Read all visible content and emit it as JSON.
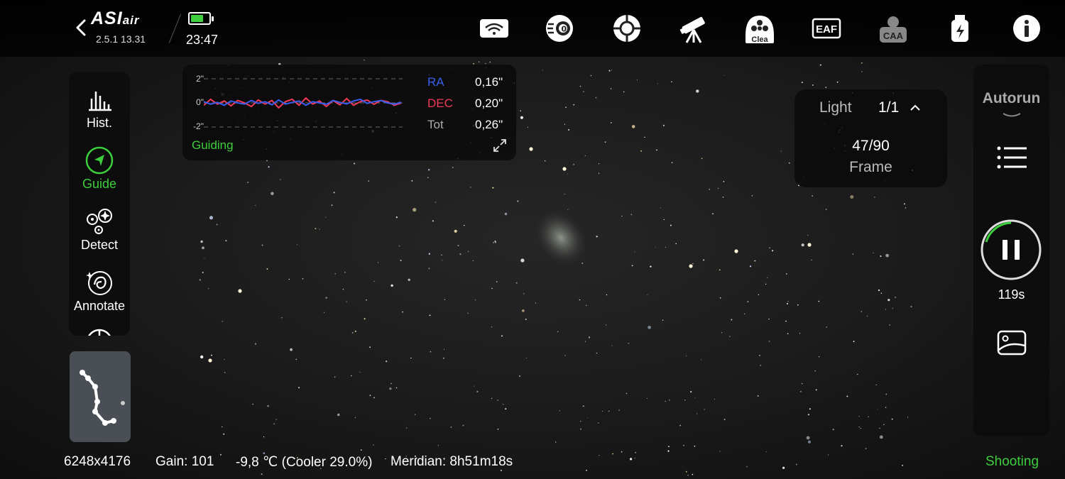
{
  "app": {
    "logo_main": "ASI",
    "logo_sub": "air",
    "version": "2.5.1 13.31",
    "clock": "23:47",
    "battery_level": 0.7
  },
  "topbar": {
    "icons": [
      {
        "name": "wifi-icon",
        "label": ""
      },
      {
        "name": "camera-main-icon",
        "label": ""
      },
      {
        "name": "guide-camera-icon",
        "label": ""
      },
      {
        "name": "telescope-mount-icon",
        "label": ""
      },
      {
        "name": "filter-wheel-icon",
        "label": "Clea"
      },
      {
        "name": "eaf-icon",
        "label": "EAF"
      },
      {
        "name": "caa-icon",
        "label": "CAA"
      },
      {
        "name": "usb-storage-icon",
        "label": ""
      },
      {
        "name": "info-icon",
        "label": ""
      }
    ]
  },
  "sidebar": {
    "items": [
      {
        "name": "hist",
        "label": "Hist.",
        "icon": "histogram-icon",
        "active": false
      },
      {
        "name": "guide",
        "label": "Guide",
        "icon": "guide-arrow-icon",
        "active": true
      },
      {
        "name": "detect",
        "label": "Detect",
        "icon": "detect-icon",
        "active": false
      },
      {
        "name": "annotate",
        "label": "Annotate",
        "icon": "annotate-galaxy-icon",
        "active": false
      }
    ]
  },
  "guiding": {
    "y_ticks": [
      "2\"",
      "0\"",
      "-2\""
    ],
    "rows": [
      {
        "key": "RA",
        "value": "0,16\"",
        "color": "#3a5ef0"
      },
      {
        "key": "DEC",
        "value": "0,20\"",
        "color": "#ef3a5a"
      },
      {
        "key": "Tot",
        "value": "0,26\"",
        "color": "#aaaaaa"
      }
    ],
    "label": "Guiding",
    "ra_series": [
      0.05,
      -0.05,
      0.02,
      -0.1,
      0.08,
      0.0,
      -0.05,
      0.1,
      -0.02,
      0.05,
      -0.08,
      0.12,
      -0.05,
      0.02,
      0.08,
      -0.1,
      0.05,
      0.0,
      -0.06,
      0.1,
      0.02,
      -0.04,
      0.08,
      0.15,
      -0.02,
      0.05,
      0.1,
      0.0,
      -0.05,
      0.02
    ],
    "dec_series": [
      -0.1,
      0.15,
      -0.05,
      0.08,
      -0.12,
      0.1,
      0.0,
      -0.15,
      0.12,
      -0.05,
      0.1,
      -0.2,
      0.05,
      0.15,
      -0.1,
      0.2,
      -0.05,
      0.08,
      -0.15,
      0.1,
      -0.08,
      0.18,
      -0.1,
      0.05,
      0.12,
      -0.06,
      0.1,
      0.05,
      -0.1,
      0.0
    ]
  },
  "frame_panel": {
    "type": "Light",
    "count": "1/1",
    "frames": "47/90",
    "unit": "Frame"
  },
  "right_panel": {
    "autorun": "Autorun",
    "countdown": "119s"
  },
  "bottom": {
    "resolution": "6248x4176",
    "gain": "Gain: 101",
    "temp": "-9,8 ℃ (Cooler 29.0%)",
    "meridian": "Meridian: 8h51m18s",
    "status": "Shooting"
  },
  "colors": {
    "accent_green": "#3ccf3c",
    "ra_blue": "#3a5ef0",
    "dec_red": "#ef3a5a"
  }
}
